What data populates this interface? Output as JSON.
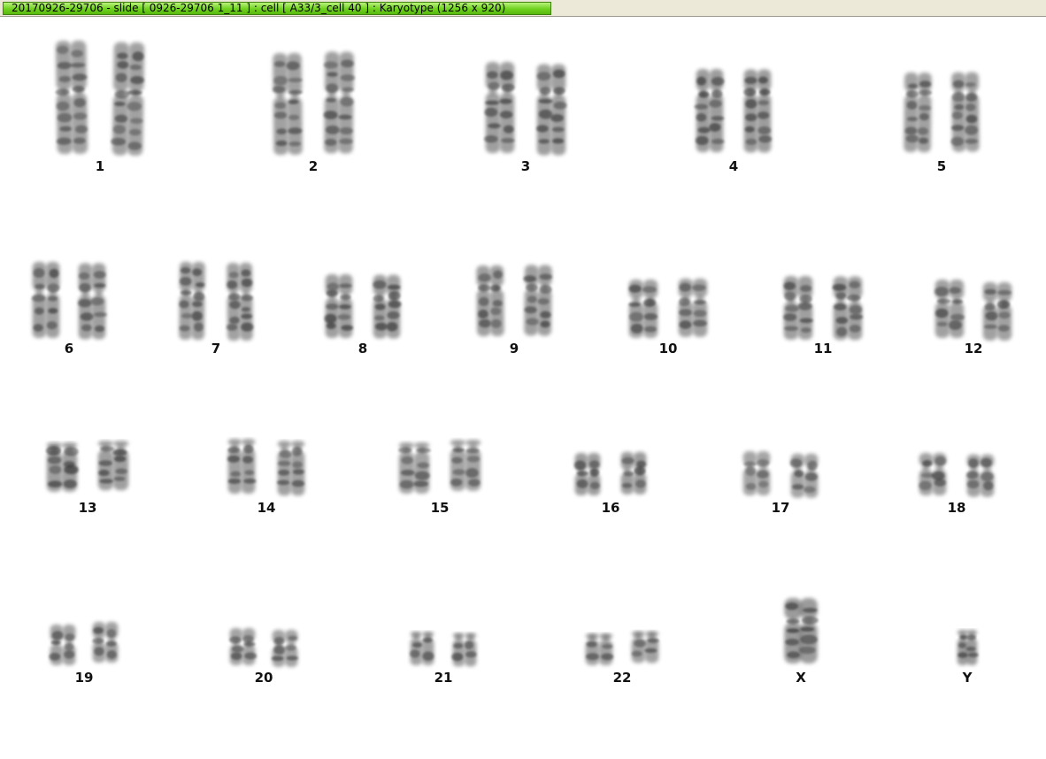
{
  "window": {
    "title": "20170926-29706 - slide [ 0926-29706 1_11 ] : cell [ A33/3_cell 40 ] : Karyotype  (1256 x 920)"
  },
  "karyotype": {
    "labels": [
      "1",
      "2",
      "3",
      "4",
      "5",
      "6",
      "7",
      "8",
      "9",
      "10",
      "11",
      "12",
      "13",
      "14",
      "15",
      "16",
      "17",
      "18",
      "19",
      "20",
      "21",
      "22",
      "X",
      "Y"
    ]
  }
}
